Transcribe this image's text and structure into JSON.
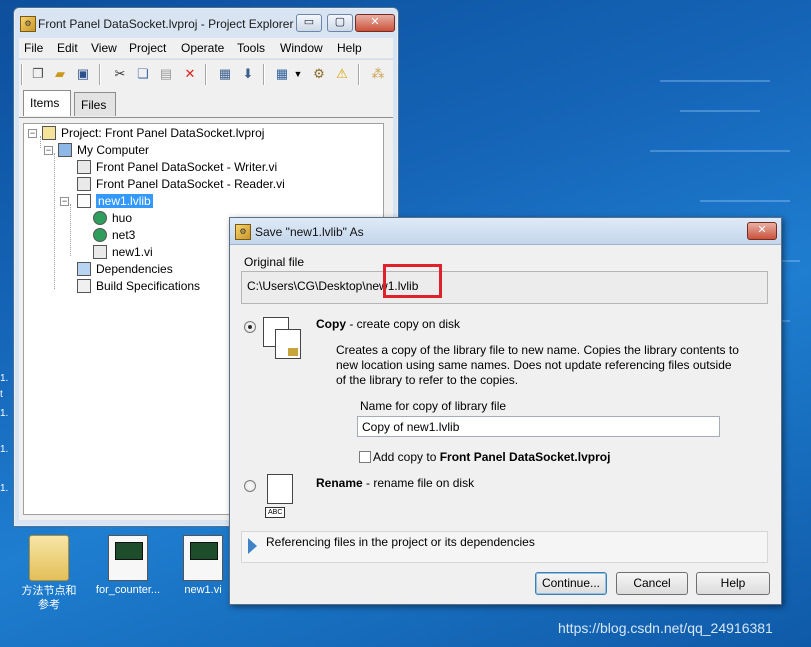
{
  "project_explorer": {
    "title": "Front Panel DataSocket.lvproj - Project Explorer",
    "caption_buttons": {
      "minimize": "▭",
      "maximize": "▢",
      "close": "✕"
    },
    "menus": [
      "File",
      "Edit",
      "View",
      "Project",
      "Operate",
      "Tools",
      "Window",
      "Help"
    ],
    "toolbar_icons": [
      "new-icon",
      "open-icon",
      "save-all-icon",
      "cut-icon",
      "copy-icon",
      "paste-icon",
      "delete-icon",
      "build-icon",
      "deploy-icon",
      "view-dropdown-icon",
      "properties-icon",
      "warning-icon",
      "collapse-icon"
    ],
    "tabs": [
      "Items",
      "Files"
    ],
    "tree": [
      {
        "label": "Project: Front Panel DataSocket.lvproj",
        "icon": "project-icon"
      },
      {
        "label": "My Computer",
        "icon": "computer-icon"
      },
      {
        "label": "Front Panel DataSocket - Writer.vi",
        "icon": "vi-icon"
      },
      {
        "label": "Front Panel DataSocket - Reader.vi",
        "icon": "vi-icon"
      },
      {
        "label": "new1.lvlib",
        "icon": "library-icon",
        "selected": true
      },
      {
        "label": "huo",
        "icon": "shared-variable-icon"
      },
      {
        "label": "net3",
        "icon": "shared-variable-icon"
      },
      {
        "label": "new1.vi",
        "icon": "vi-icon"
      },
      {
        "label": "Dependencies",
        "icon": "dependencies-icon"
      },
      {
        "label": "Build Specifications",
        "icon": "build-specifications-icon"
      }
    ]
  },
  "desktop": {
    "icons": [
      {
        "label": "方法节点和\n参考",
        "icon": "folder-icon"
      },
      {
        "label": "for_counter...",
        "icon": "vi-file-icon"
      },
      {
        "label": "new1.vi",
        "icon": "vi-file-icon"
      }
    ],
    "edge_labels": [
      "1.",
      "t",
      "1.",
      "1.",
      "1."
    ]
  },
  "save_dialog": {
    "title": "Save \"new1.lvlib\" As",
    "close_label": "✕",
    "original_file_label": "Original file",
    "original_file_path": "C:\\Users\\CG\\Desktop\\new1.lvlib",
    "copy_option": {
      "title": "Copy",
      "subtitle": " - create copy on disk",
      "selected": true,
      "description_lines": [
        "Creates a copy of the library file to new name. Copies the library contents to",
        "new location using same names. Does not update referencing files outside",
        "of the library to refer to the copies."
      ],
      "name_label": "Name for copy of library file",
      "name_value": "Copy of new1.lvlib",
      "add_to_project_prefix": "Add copy to ",
      "add_to_project_name": "Front Panel DataSocket.lvproj",
      "add_to_project_checked": false
    },
    "rename_option": {
      "title": "Rename",
      "subtitle": " - rename file on disk",
      "selected": false,
      "icon_tag": "ABC"
    },
    "referencing_label": "Referencing files in the project or its dependencies",
    "buttons": {
      "continue": "Continue...",
      "cancel": "Cancel",
      "help": "Help"
    }
  },
  "watermark": "https://blog.csdn.net/qq_24916381"
}
